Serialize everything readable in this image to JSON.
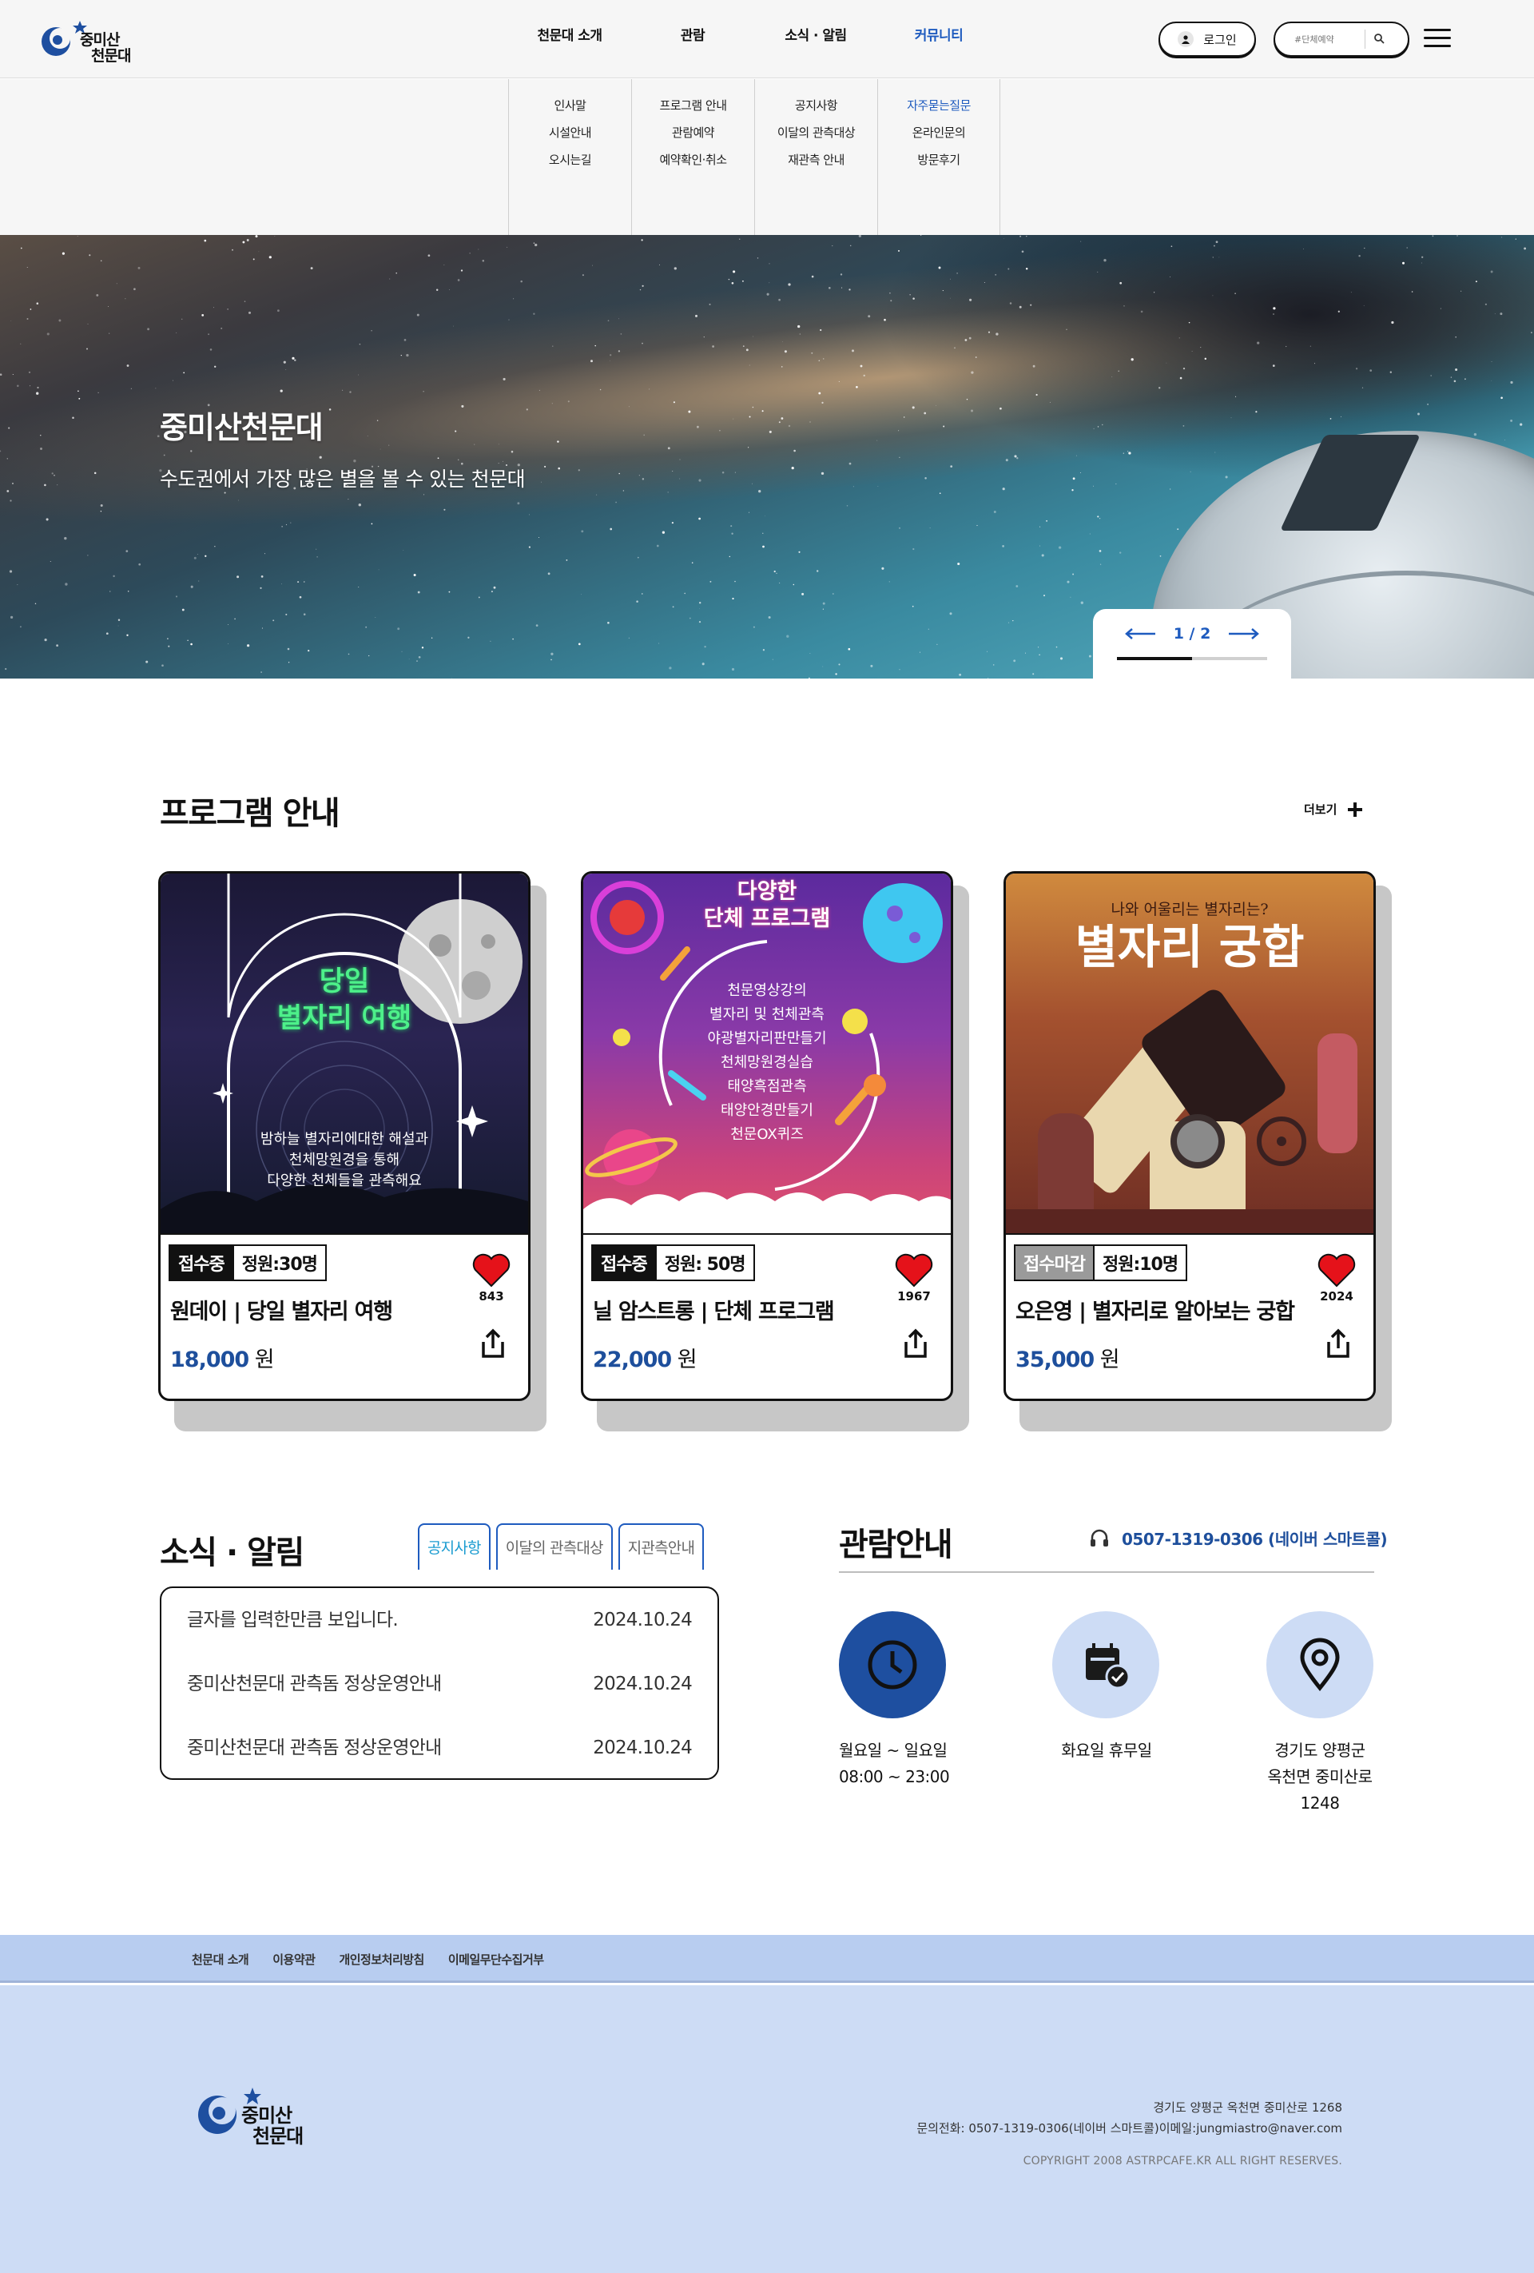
{
  "header": {
    "logo_name": "중미산",
    "logo_name2": "천문대",
    "login_label": "로그인",
    "search_placeholder": "#단체예약",
    "gnb": [
      {
        "label": "천문대 소개"
      },
      {
        "label": "관람"
      },
      {
        "label": "소식 · 알림"
      },
      {
        "label": "커뮤니티"
      }
    ]
  },
  "mega_menu": [
    {
      "items": [
        "인사말",
        "시설안내",
        "오시는길"
      ]
    },
    {
      "items": [
        "프로그램 안내",
        "관람예약",
        "예약확인·취소"
      ]
    },
    {
      "items": [
        "공지사항",
        "이달의 관측대상",
        "재관측 안내"
      ]
    },
    {
      "items": [
        "자주묻는질문",
        "온라인문의",
        "방문후기"
      ]
    }
  ],
  "hero": {
    "title": "중미산천문대",
    "subtitle": "수도권에서 가장 많은 별을 볼 수 있는 천문대",
    "slide_counter": "1 / 2",
    "slide_progress": 0.5
  },
  "programs": {
    "section_title": "프로그램 안내",
    "more_label": "더보기",
    "cards": [
      {
        "status": "접수중",
        "capacity": "정원:30명",
        "name": "원데이 | 당일 별자리 여행",
        "price": "18,000",
        "unit": "원",
        "likes": "843",
        "poster_title_1": "당일",
        "poster_title_2": "별자리 여행",
        "poster_lines": [
          "밤하늘 별자리에대한 해설과",
          "천체망원경을 통해",
          "다양한 천체들을 관측해요"
        ]
      },
      {
        "status": "접수중",
        "capacity": "정원: 50명",
        "name": "닐 암스트롱 | 단체 프로그램",
        "price": "22,000",
        "unit": "원",
        "likes": "1967",
        "poster_title_1": "다양한",
        "poster_title_2": "단체 프로그램",
        "poster_lines": [
          "천문영상강의",
          "별자리 및 천체관측",
          "야광별자리판만들기",
          "천체망원경실습",
          "태양흑점관측",
          "태양안경만들기",
          "천문OX퀴즈"
        ]
      },
      {
        "status": "접수마감",
        "capacity": "정원:10명",
        "name": "오은영 | 별자리로 알아보는 궁합",
        "price": "35,000",
        "unit": "원",
        "likes": "2024",
        "poster_title_1": "나와 어울리는 별자리는?",
        "poster_title_2": "별자리 궁합",
        "poster_lines": []
      }
    ]
  },
  "news": {
    "section_title": "소식 · 알림",
    "tabs": [
      "공지사항",
      "이달의 관측대상",
      "지관측안내"
    ],
    "rows": [
      {
        "title": "글자를 입력한만큼 보입니다.",
        "date": "2024.10.24"
      },
      {
        "title": "중미산천문대 관측돔 정상운영안내",
        "date": "2024.10.24"
      },
      {
        "title": "중미산천문대 관측돔 정상운영안내",
        "date": "2024.10.24"
      }
    ]
  },
  "visit": {
    "section_title": "관람안내",
    "phone": "0507-1319-0306 (네이버 스마트콜)",
    "hours_line1": "월요일 ~ 일요일",
    "hours_line2": "08:00 ~ 23:00",
    "closed": "화요일 휴무일",
    "address_line1": "경기도 양평군",
    "address_line2": "옥천면 중미산로",
    "address_line3": "1248"
  },
  "footer": {
    "links": [
      "천문대 소개",
      "이용약관",
      "개인정보처리방침",
      "이메일무단수집거부"
    ],
    "address": "경기도 양평군 옥천면 중미산로 1268",
    "contact": "문의전화: 0507-1319-0306(네이버 스마트콜)이메일:jungmiastro@naver.com",
    "copyright": "COPYRIGHT 2008 ASTRPCAFE.KR ALL RIGHT RESERVES.",
    "logo_name": "중미산",
    "logo_name2": "천문대"
  },
  "colors": {
    "accent": "#1e5bbf",
    "price": "#1e4f9c",
    "footer_bg": "#cddcf5",
    "footer_nav_bg": "#b8cdf0",
    "heart": "#e5121a"
  }
}
